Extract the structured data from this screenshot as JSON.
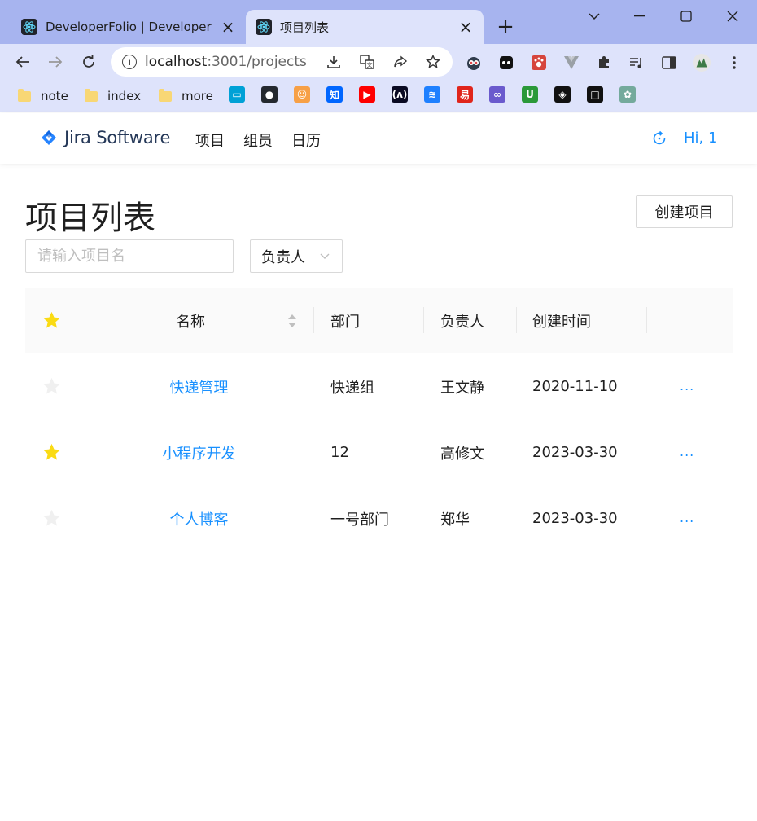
{
  "browser": {
    "tabs": [
      {
        "title": "DeveloperFolio | Developer Po",
        "active": false
      },
      {
        "title": "项目列表",
        "active": true
      }
    ],
    "url_host": "localhost",
    "url_path": ":3001/projects",
    "bookmarks": [
      {
        "label": "note"
      },
      {
        "label": "index"
      },
      {
        "label": "more"
      }
    ],
    "bookmark_icons": [
      {
        "name": "bilibili-icon",
        "glyph": "▭",
        "color": "#00a1d6"
      },
      {
        "name": "github-icon",
        "glyph": "●",
        "color": "#24292f"
      },
      {
        "name": "avatar-bookmark-icon",
        "glyph": "☺",
        "color": "#f7a046"
      },
      {
        "name": "zhihu-icon",
        "glyph": "知",
        "color": "#0066ff"
      },
      {
        "name": "youtube-icon",
        "glyph": "▶",
        "color": "#ff0000"
      },
      {
        "name": "freecodecamp-icon",
        "glyph": "(ʌ)",
        "color": "#0a0a23"
      },
      {
        "name": "juejin-icon",
        "glyph": "≋",
        "color": "#1e80ff"
      },
      {
        "name": "leetcode-icon",
        "glyph": "易",
        "color": "#e0251b"
      },
      {
        "name": "link-icon",
        "glyph": "∞",
        "color": "#6a5acd"
      },
      {
        "name": "uniapp-icon",
        "glyph": "U",
        "color": "#2b9939"
      },
      {
        "name": "codepen-icon",
        "glyph": "◈",
        "color": "#111111"
      },
      {
        "name": "square-icon",
        "glyph": "□",
        "color": "#111111"
      },
      {
        "name": "chatgpt-icon",
        "glyph": "✿",
        "color": "#74aa9c"
      }
    ]
  },
  "header": {
    "logo_text": "Jira Software",
    "nav": [
      "项目",
      "组员",
      "日历"
    ],
    "greeting": "Hi, 1"
  },
  "main": {
    "title": "项目列表",
    "create_button": "创建项目",
    "search_placeholder": "请输入项目名",
    "person_select_value": "负责人"
  },
  "table": {
    "columns": [
      "名称",
      "部门",
      "负责人",
      "创建时间"
    ],
    "rows": [
      {
        "pinned": false,
        "name": "快递管理",
        "department": "快递组",
        "owner": "王文静",
        "created": "2020-11-10",
        "more": "..."
      },
      {
        "pinned": true,
        "name": "小程序开发",
        "department": "12",
        "owner": "高修文",
        "created": "2023-03-30",
        "more": "..."
      },
      {
        "pinned": false,
        "name": "个人博客",
        "department": "一号部门",
        "owner": "郑华",
        "created": "2023-03-30",
        "more": "..."
      }
    ]
  },
  "colors": {
    "tabbar": "#a7b4ef",
    "toolbar": "#dee3fb",
    "link": "#1890ff",
    "star_on": "#fadb14",
    "star_off": "#f0f0f0"
  }
}
